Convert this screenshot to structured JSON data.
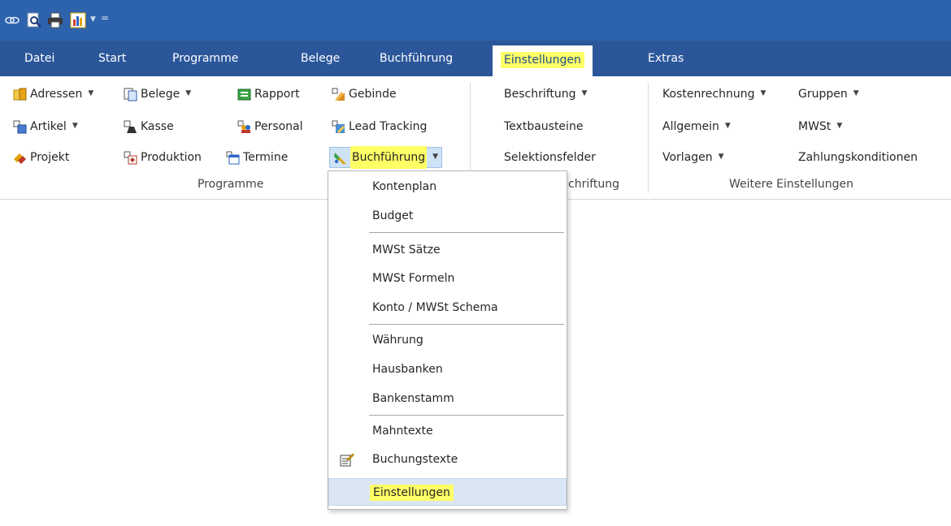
{
  "qat": {
    "icons": [
      "link-icon",
      "print-preview-icon",
      "print-icon",
      "chart-icon",
      "customize-icon"
    ],
    "customize_glyph": "="
  },
  "tabs": [
    {
      "label": "Datei"
    },
    {
      "label": "Start"
    },
    {
      "label": "Programme"
    },
    {
      "label": "Belege"
    },
    {
      "label": "Buchführung"
    },
    {
      "label": "Einstellungen",
      "active": true
    },
    {
      "label": "Extras"
    }
  ],
  "ribbon": {
    "programme": {
      "group_label": "Programme",
      "adressen": "Adressen",
      "belege": "Belege",
      "rapport": "Rapport",
      "gebinde": "Gebinde",
      "artikel": "Artikel",
      "kasse": "Kasse",
      "personal": "Personal",
      "lead_tracking": "Lead Tracking",
      "projekt": "Projekt",
      "produktion": "Produktion",
      "termine": "Termine",
      "buchfuehrung": "Buchführung"
    },
    "beschriftung": {
      "group_label": "chriftung",
      "beschriftung": "Beschriftung",
      "textbausteine": "Textbausteine",
      "selektionsfelder": "Selektionsfelder"
    },
    "weitere": {
      "group_label": "Weitere Einstellungen",
      "kostenrechnung": "Kostenrechnung",
      "gruppen": "Gruppen",
      "allgemein": "Allgemein",
      "mwst": "MWSt",
      "vorlagen": "Vorlagen",
      "zahlungskonditionen": "Zahlungskonditionen"
    }
  },
  "dropdown": {
    "items": [
      {
        "label": "Kontenplan"
      },
      {
        "label": "Budget"
      },
      {
        "label": "MWSt Sätze"
      },
      {
        "label": "MWSt Formeln"
      },
      {
        "label": "Konto / MWSt Schema"
      },
      {
        "label": "Währung"
      },
      {
        "label": "Hausbanken"
      },
      {
        "label": "Bankenstamm"
      },
      {
        "label": "Mahntexte"
      },
      {
        "label": "Buchungstexte",
        "icon": "document-edit-icon"
      },
      {
        "label": "Einstellungen",
        "selected": true
      }
    ]
  },
  "colors": {
    "ribbon_header": "#2b579a",
    "highlight": "#ffff66",
    "selection": "#dbe6f4"
  }
}
